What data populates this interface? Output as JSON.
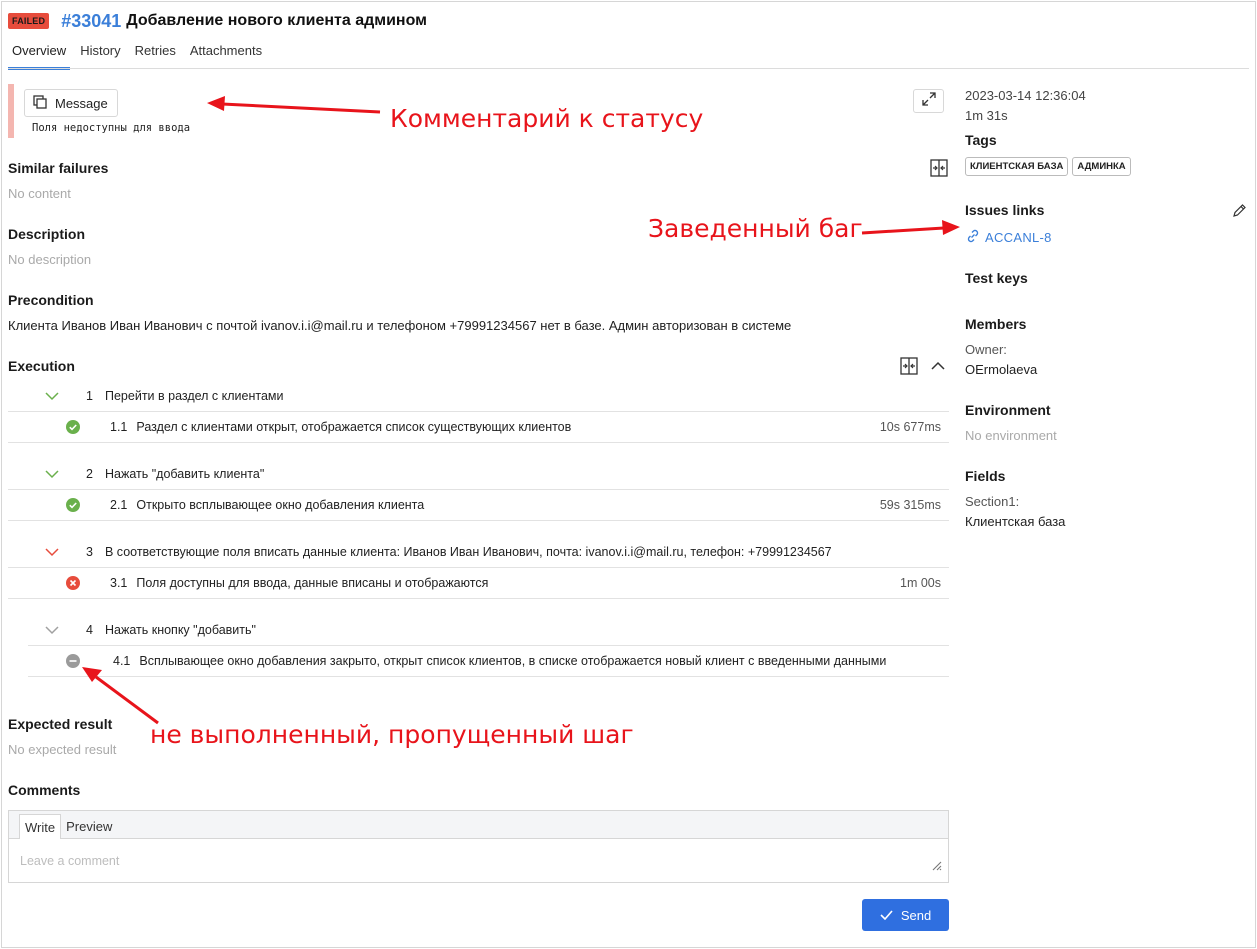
{
  "header": {
    "status_badge": "FAILED",
    "ticket_id": "#33041",
    "title": "Добавление нового клиента админом"
  },
  "tabs": [
    {
      "label": "Overview",
      "active": true
    },
    {
      "label": "History"
    },
    {
      "label": "Retries"
    },
    {
      "label": "Attachments"
    }
  ],
  "message": {
    "button_label": "Message",
    "text": "Поля недоступны для ввода"
  },
  "sections": {
    "similar_failures": {
      "title": "Similar failures",
      "value": "No content"
    },
    "description": {
      "title": "Description",
      "value": "No description"
    },
    "precondition": {
      "title": "Precondition",
      "value": "Клиента Иванов Иван Иванович с почтой ivanov.i.i@mail.ru и телефоном +79991234567 нет в базе. Админ авторизован в системе"
    },
    "execution": {
      "title": "Execution"
    },
    "expected_result": {
      "title": "Expected result",
      "value": "No expected result"
    },
    "comments": {
      "title": "Comments"
    }
  },
  "steps": [
    {
      "num": "1",
      "label": "Перейти в раздел с клиентами",
      "chevron_color": "#6ab04c",
      "result": {
        "num": "1.1",
        "label": "Раздел с клиентами открыт, отображается список существующих клиентов",
        "duration": "10s 677ms",
        "status": "passed"
      }
    },
    {
      "num": "2",
      "label": "Нажать \"добавить клиента\"",
      "chevron_color": "#6ab04c",
      "result": {
        "num": "2.1",
        "label": "Открыто всплывающее окно добавления клиента",
        "duration": "59s 315ms",
        "status": "passed"
      }
    },
    {
      "num": "3",
      "label": "В соответствующие поля вписать данные клиента: Иванов Иван Иванович, почта: ivanov.i.i@mail.ru, телефон: +79991234567",
      "chevron_color": "#e74c3c",
      "result": {
        "num": "3.1",
        "label": "Поля доступны для ввода, данные вписаны и отображаются",
        "duration": "1m 00s",
        "status": "failed"
      }
    },
    {
      "num": "4",
      "label": "Нажать кнопку \"добавить\"",
      "chevron_color": "#a0a0a0",
      "result": {
        "num": "4.1",
        "label": "Всплывающее окно добавления закрыто, открыт список клиентов, в списке отображается новый клиент с введенными данными",
        "duration": "",
        "status": "skipped"
      }
    }
  ],
  "sidebar": {
    "datetime": "2023-03-14 12:36:04",
    "duration": "1m 31s",
    "tags_title": "Tags",
    "tags": [
      "КЛИЕНТСКАЯ БАЗА",
      "АДМИНКА"
    ],
    "issues_title": "Issues links",
    "issue": "ACCANL-8",
    "test_keys_title": "Test keys",
    "members_title": "Members",
    "owner_label": "Owner:",
    "owner": "OErmolaeva",
    "environment_title": "Environment",
    "environment_value": "No environment",
    "fields_title": "Fields",
    "field_label": "Section1:",
    "field_value": "Клиентская база"
  },
  "comments": {
    "write_tab": "Write",
    "preview_tab": "Preview",
    "placeholder": "Leave a comment",
    "send_label": "Send"
  },
  "annotations": {
    "status_comment": "Комментарий к статусу",
    "bug_filed": "Заведенный баг",
    "skipped_step": "не выполненный, пропущенный шаг"
  },
  "colors": {
    "accent": "#3b7fd9",
    "failed": "#e74c3c",
    "passed": "#6ab04c",
    "skipped": "#a0a0a0",
    "annotation": "#e8141b",
    "send_button": "#2f6fe0"
  }
}
